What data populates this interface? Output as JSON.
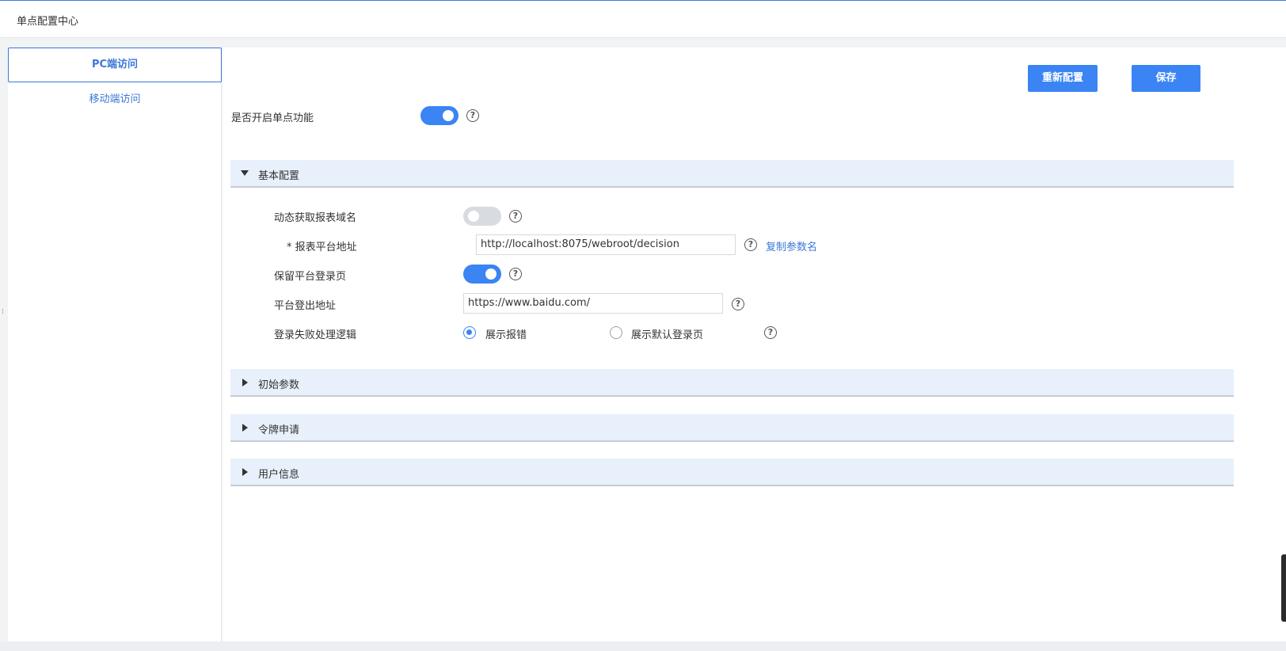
{
  "app": {
    "title": "单点配置中心"
  },
  "sidebar": {
    "tabs": [
      {
        "label": "PC端访问",
        "active": true
      },
      {
        "label": "移动端访问",
        "active": false
      }
    ]
  },
  "toolbar": {
    "reconfigure_label": "重新配置",
    "save_label": "保存"
  },
  "sso_enable": {
    "label": "是否开启单点功能",
    "value": true
  },
  "sections": {
    "basic": {
      "title": "基本配置",
      "expanded": true,
      "fields": {
        "dynamic_domain": {
          "label": "动态获取报表域名",
          "value": false
        },
        "platform_url": {
          "label": "* 报表平台地址",
          "value": "http://localhost:8075/webroot/decision",
          "copy_link": "复制参数名"
        },
        "keep_login_page": {
          "label": "保留平台登录页",
          "value": true
        },
        "logout_url": {
          "label": "平台登出地址",
          "value": "https://www.baidu.com/"
        },
        "login_fail": {
          "label": "登录失败处理逻辑",
          "options": [
            "展示报错",
            "展示默认登录页"
          ],
          "selected": "展示报错"
        }
      }
    },
    "init_params": {
      "title": "初始参数",
      "expanded": false
    },
    "token_request": {
      "title": "令牌申请",
      "expanded": false
    },
    "user_info": {
      "title": "用户信息",
      "expanded": false
    }
  },
  "icons": {
    "help": "?",
    "expanded": "caret-down-icon",
    "collapsed": "caret-right-icon"
  },
  "colors": {
    "accent": "#3a84f4",
    "link": "#3a78d8",
    "section_bg": "#e8f0fb"
  }
}
